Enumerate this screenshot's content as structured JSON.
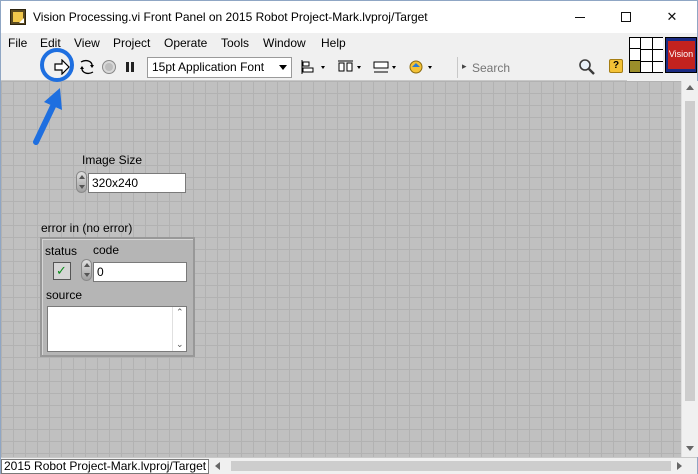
{
  "window": {
    "title": "Vision Processing.vi Front Panel on 2015 Robot Project-Mark.lvproj/Target"
  },
  "menu": [
    {
      "label": "File"
    },
    {
      "label": "Edit"
    },
    {
      "label": "View"
    },
    {
      "label": "Project"
    },
    {
      "label": "Operate"
    },
    {
      "label": "Tools"
    },
    {
      "label": "Window"
    },
    {
      "label": "Help"
    }
  ],
  "toolbar": {
    "font_selector": "15pt Application Font",
    "search_placeholder": "Search"
  },
  "vi_icon": {
    "label": "Vision"
  },
  "colors": {
    "highlight": "#1e6fe0",
    "panel_grid": "#c0c0c0",
    "status_ok": "#0a8c1a"
  },
  "controls": {
    "image_size": {
      "label": "Image Size",
      "value": "320x240"
    },
    "error_in": {
      "label": "error in (no error)",
      "status_label": "status",
      "code_label": "code",
      "code_value": "0",
      "source_label": "source",
      "source_value": ""
    }
  },
  "statusbar": {
    "project_target": "2015 Robot Project-Mark.lvproj/Target"
  }
}
